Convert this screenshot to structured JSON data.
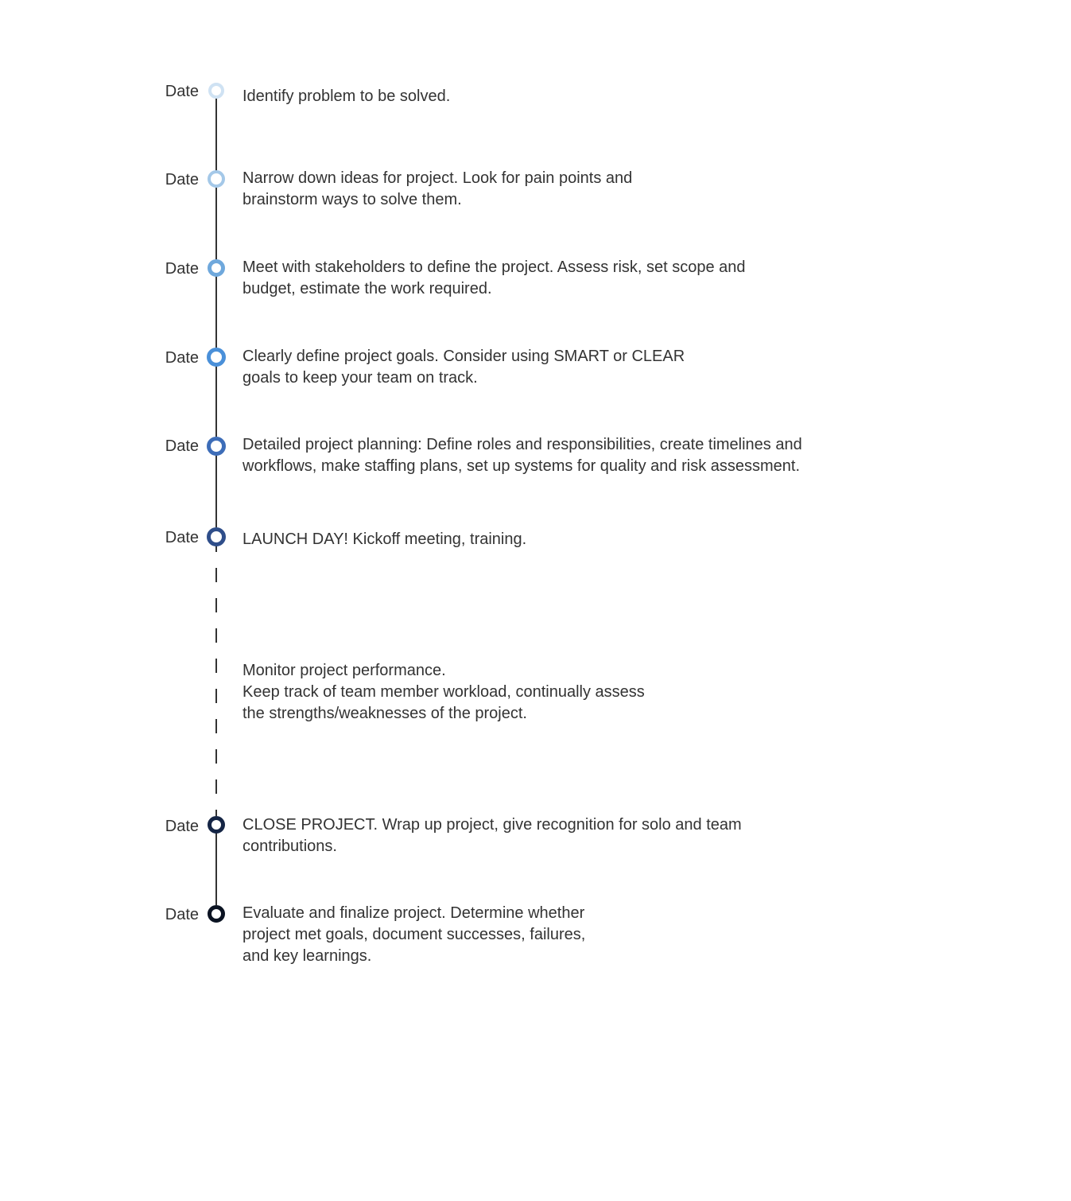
{
  "timeline": {
    "dateLabel": "Date",
    "items": [
      {
        "desc": "Identify problem to be solved."
      },
      {
        "desc": "Narrow down ideas for project. Look for pain points and brainstorm ways to solve them."
      },
      {
        "desc": "Meet with stakeholders to define the project. Assess risk, set scope and budget, estimate the work required."
      },
      {
        "desc": "Clearly define project goals. Consider using SMART or CLEAR goals to keep your team on track."
      },
      {
        "desc": "Detailed project planning: Define roles and responsibilities, create timelines and workflows, make staffing plans, set up systems for quality and risk assessment."
      },
      {
        "desc": "LAUNCH DAY! Kickoff meeting, training."
      },
      {
        "desc": "Monitor project performance.\nKeep track of team member workload, continually assess the strengths/weaknesses of the project."
      },
      {
        "desc": "CLOSE PROJECT. Wrap up project, give recognition for solo and team contributions."
      },
      {
        "desc": "Evaluate and finalize project. Determine whether project met goals, document successes, failures, and key learnings."
      }
    ],
    "nodeColors": [
      "#cfe2f3",
      "#a4c8e8",
      "#6fa8dc",
      "#4a90d9",
      "#3d6db8",
      "#2f4e8a",
      "#203864",
      "#152545",
      "#0b1322"
    ]
  }
}
